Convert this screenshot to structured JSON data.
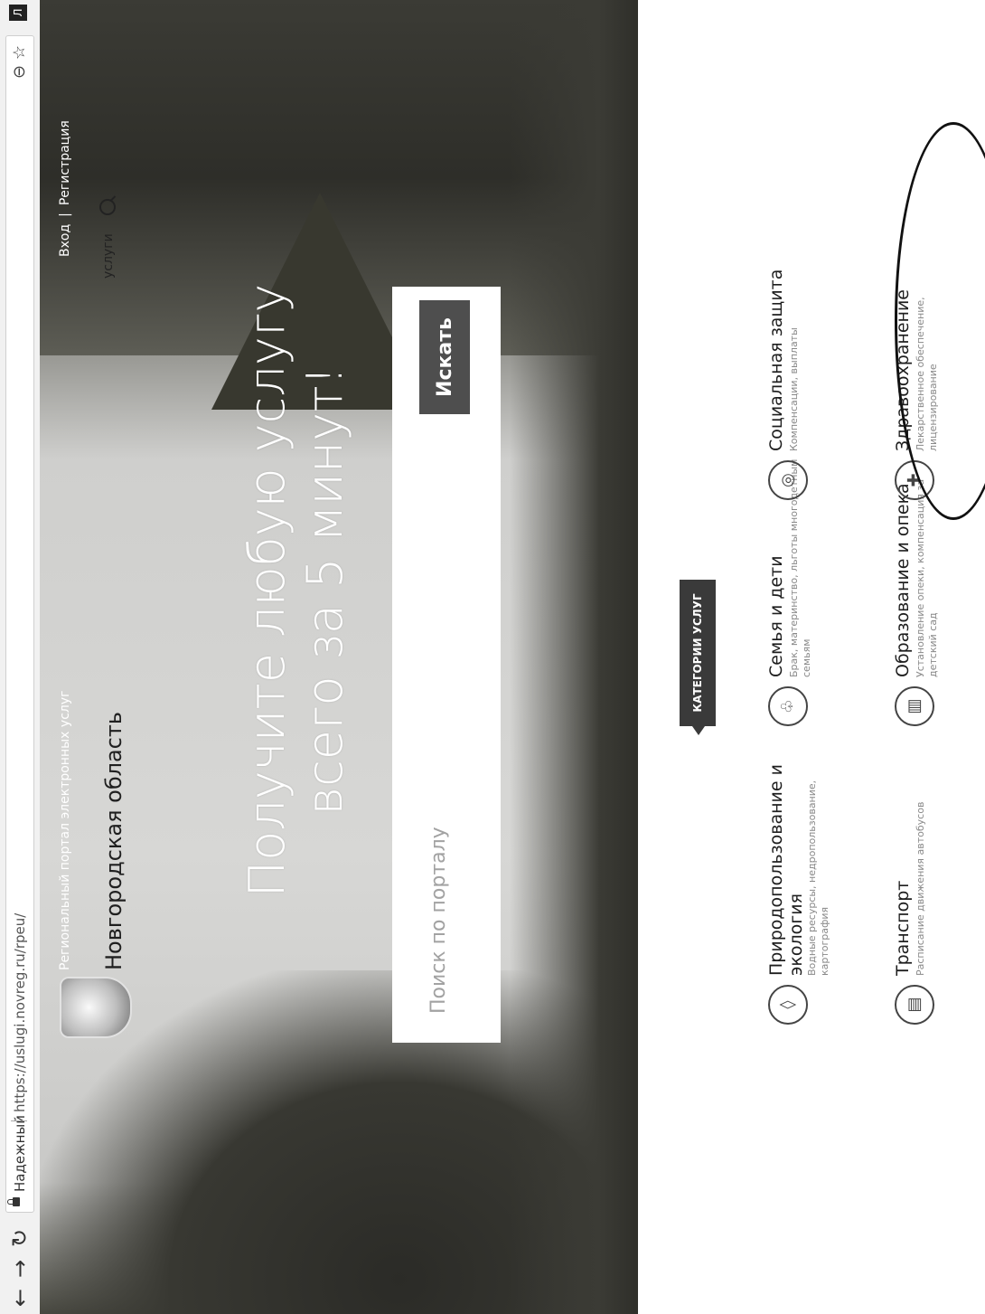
{
  "browser": {
    "secure_label": "Надежный",
    "url": "https://uslugi.novreg.ru/rpeu/",
    "ext_label": "Л"
  },
  "header": {
    "portal_name": "Региональный портал электронных услуг",
    "region": "Новгородская область",
    "login": "Вход",
    "separator": "|",
    "register": "Регистрация",
    "services": "услуги"
  },
  "hero": {
    "headline_line1": "Получите любую услугу",
    "headline_line2": "всего за 5 минут!",
    "search_placeholder": "Поиск по порталу",
    "search_button": "Искать"
  },
  "categories": {
    "title": "КАТЕГОРИИ УСЛУГ",
    "items": [
      {
        "name": "Природопользование и экология",
        "desc": "Водные ресурсы, недропользование, картография"
      },
      {
        "name": "Семья и дети",
        "desc": "Брак, материнство, льготы многодетным семьям"
      },
      {
        "name": "Социальная защита",
        "desc": "Компенсации, выплаты"
      },
      {
        "name": "Транспорт",
        "desc": "Расписание движения автобусов"
      },
      {
        "name": "Образование и опека",
        "desc": "Установление опеки, компенсация за детский сад"
      },
      {
        "name": "Здравоохранение",
        "desc": "Лекарственное обеспечение, лицензирование"
      }
    ]
  }
}
